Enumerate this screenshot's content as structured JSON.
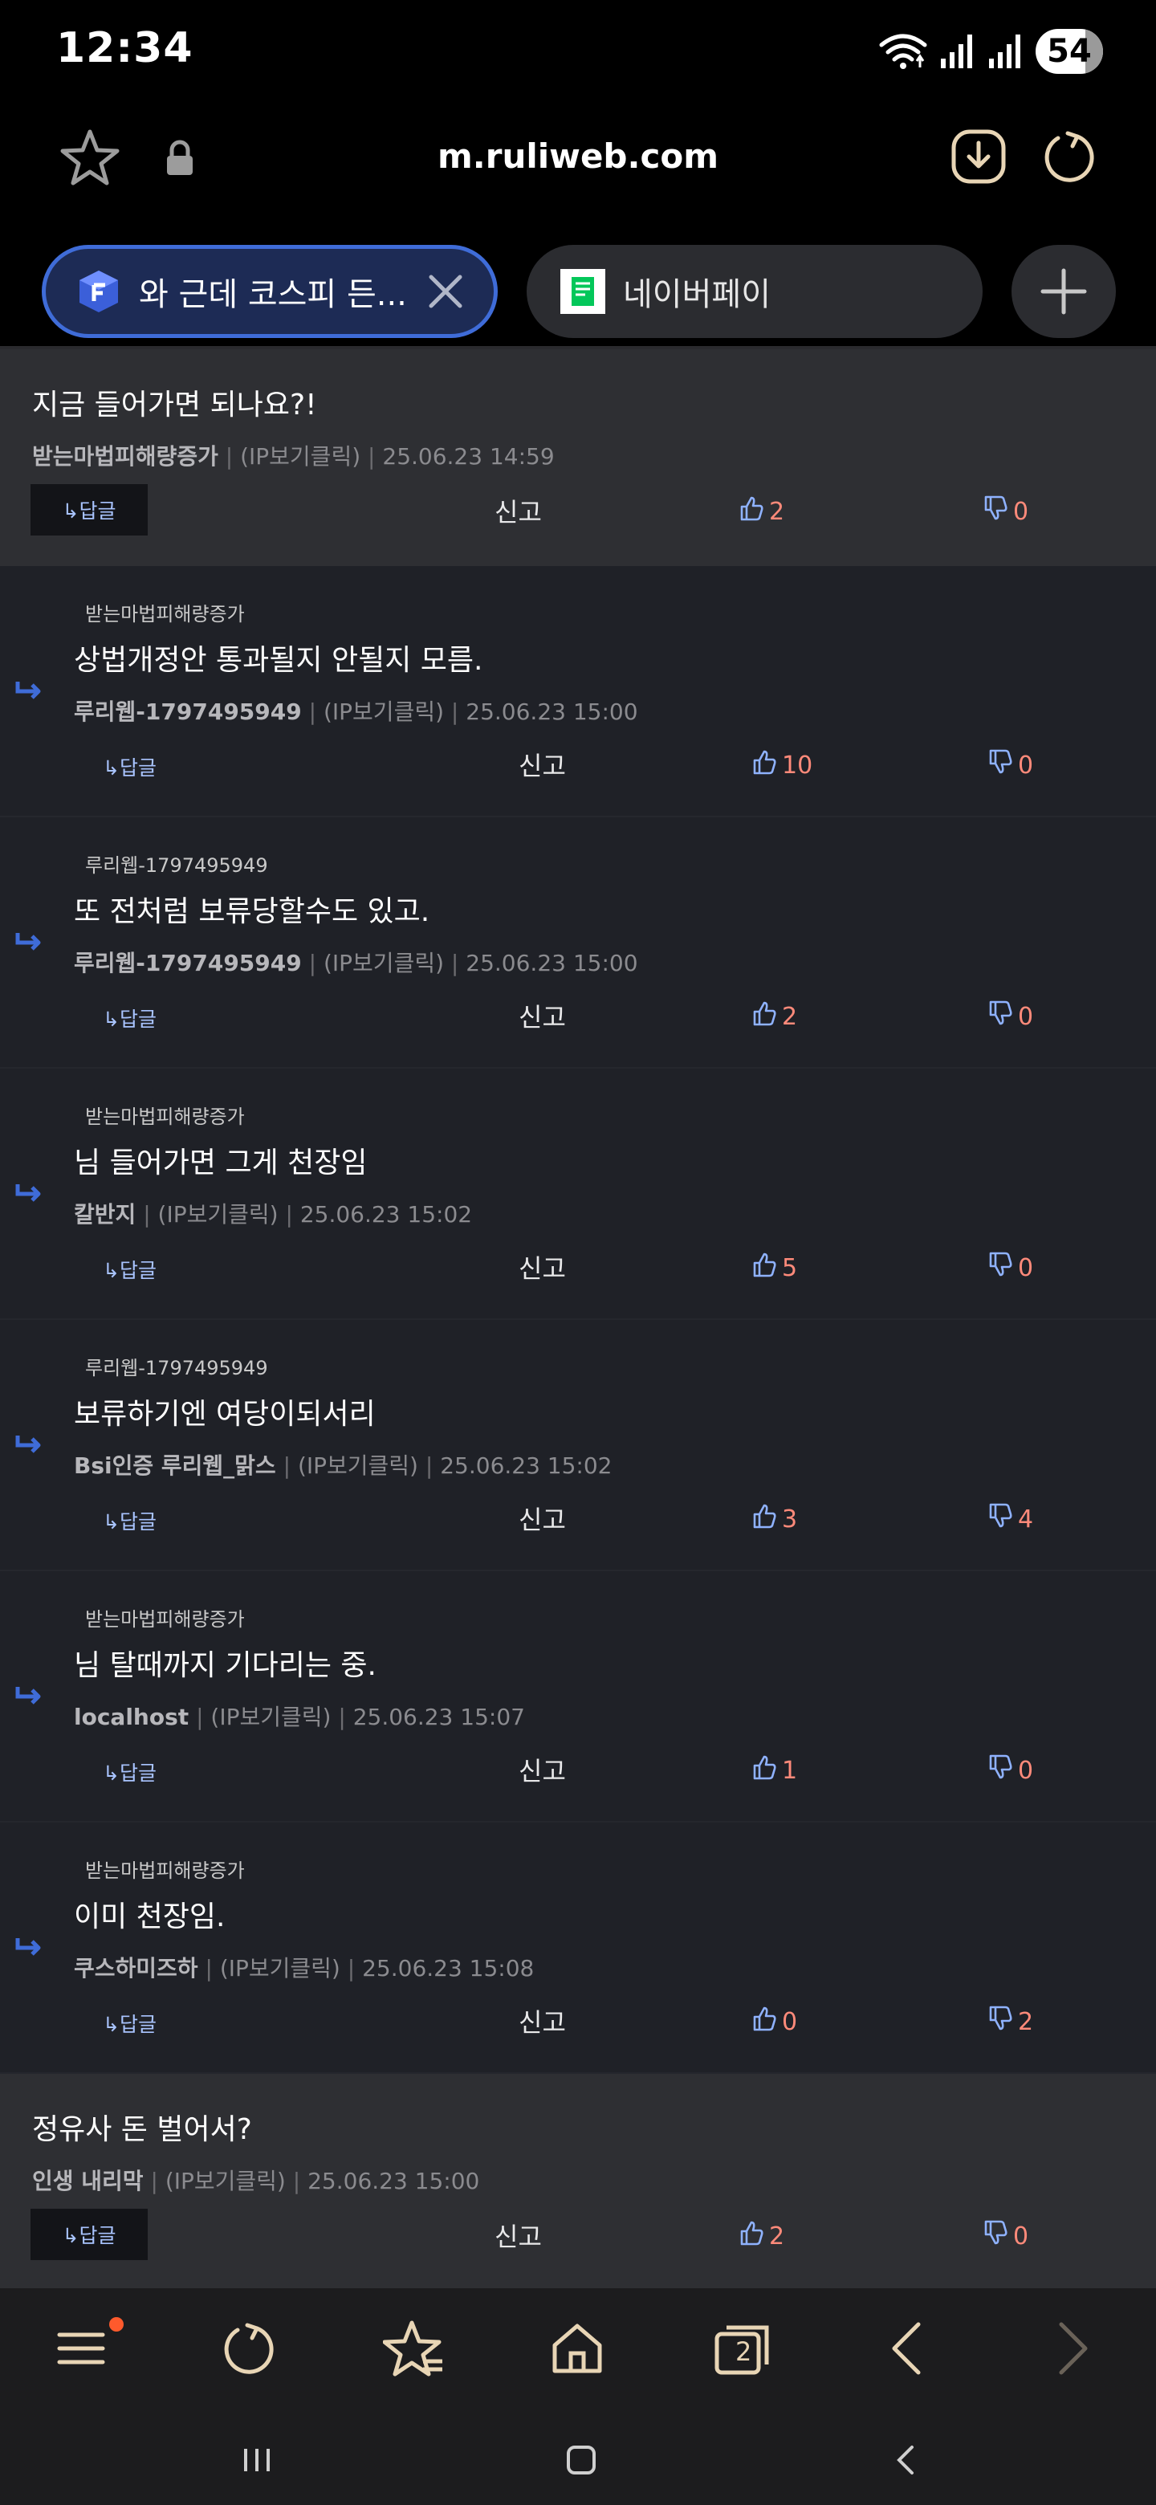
{
  "status_bar": {
    "time": "12:34",
    "battery": "54"
  },
  "address_bar": {
    "url": "m.ruliweb.com"
  },
  "tabs": [
    {
      "title": "와 근데 코스피 든...",
      "active": true
    },
    {
      "title": "네이버페이",
      "active": false
    }
  ],
  "labels": {
    "reply": "↳답글",
    "report": "신고",
    "ip": "(IP보기클릭)"
  },
  "comments": [
    {
      "type": "top",
      "text": "지금 들어가면 되나요?!",
      "author": "받는마법피해량증가",
      "datetime": "25.06.23 14:59",
      "up": "2",
      "down": "0"
    },
    {
      "type": "reply",
      "to": "받는마법피해량증가",
      "text": "상법개정안 통과될지 안될지 모름.",
      "author": "루리웹-1797495949",
      "datetime": "25.06.23 15:00",
      "up": "10",
      "down": "0"
    },
    {
      "type": "reply",
      "to": "루리웹-1797495949",
      "text": "또 전처럼 보류당할수도 있고.",
      "author": "루리웹-1797495949",
      "datetime": "25.06.23 15:00",
      "up": "2",
      "down": "0"
    },
    {
      "type": "reply",
      "to": "받는마법피해량증가",
      "text": "님 들어가면 그게 천장임",
      "author": "칼반지",
      "datetime": "25.06.23 15:02",
      "up": "5",
      "down": "0"
    },
    {
      "type": "reply",
      "to": "루리웹-1797495949",
      "text": "보류하기엔 여당이되서리",
      "author": "Bsi인증 루리웹_맑스",
      "datetime": "25.06.23 15:02",
      "up": "3",
      "down": "4"
    },
    {
      "type": "reply",
      "to": "받는마법피해량증가",
      "text": "님 탈때까지 기다리는 중.",
      "author": "localhost",
      "datetime": "25.06.23 15:07",
      "up": "1",
      "down": "0"
    },
    {
      "type": "reply",
      "to": "받는마법피해량증가",
      "text": "이미 천장임.",
      "author": "쿠스하미즈하",
      "datetime": "25.06.23 15:08",
      "up": "0",
      "down": "2"
    },
    {
      "type": "top",
      "text": "정유사 돈 벌어서?",
      "author": "인생 내리막",
      "datetime": "25.06.23 15:00",
      "up": "2",
      "down": "0"
    }
  ],
  "bottom_nav": {
    "tab_count": "2"
  },
  "colors": {
    "accent": "#3f6cd8",
    "vote_count": "#ff8a7a",
    "reply_link": "#a9c4ff",
    "reply_arrow": "#3f6cd8",
    "background": "#1f2127"
  },
  "icons": [
    "star-icon",
    "lock-icon",
    "download-icon",
    "reload-icon",
    "close-icon",
    "plus-icon",
    "thumbs-up-icon",
    "thumbs-down-icon",
    "reply-arrow-icon",
    "menu-icon",
    "home-icon",
    "tabs-icon",
    "back-icon",
    "forward-icon",
    "bookmarks-icon"
  ]
}
